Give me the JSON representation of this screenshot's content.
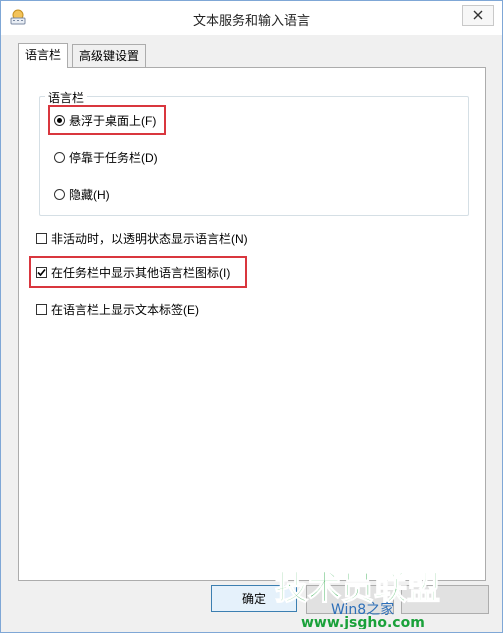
{
  "window": {
    "title": "文本服务和输入语言"
  },
  "tabs": [
    {
      "label": "语言栏",
      "active": true
    },
    {
      "label": "高级键设置",
      "active": false
    }
  ],
  "language_bar_group": {
    "legend": "语言栏",
    "options": [
      {
        "label": "悬浮于桌面上(F)",
        "checked": true
      },
      {
        "label": "停靠于任务栏(D)",
        "checked": false
      },
      {
        "label": "隐藏(H)",
        "checked": false
      }
    ]
  },
  "checkboxes": [
    {
      "label": "非活动时，以透明状态显示语言栏(N)",
      "checked": false
    },
    {
      "label": "在任务栏中显示其他语言栏图标(I)",
      "checked": true
    },
    {
      "label": "在语言栏上显示文本标签(E)",
      "checked": false
    }
  ],
  "buttons": {
    "ok": "确定"
  },
  "watermark": {
    "brand": "技术员联盟",
    "url": "www.jsgho.com",
    "tagline": "Win8之家"
  },
  "colors": {
    "highlight": "#d9363e",
    "window_border": "#7fa7d6",
    "watermark_green": "#1aa13a",
    "watermark_blue": "#2d6fb8"
  }
}
